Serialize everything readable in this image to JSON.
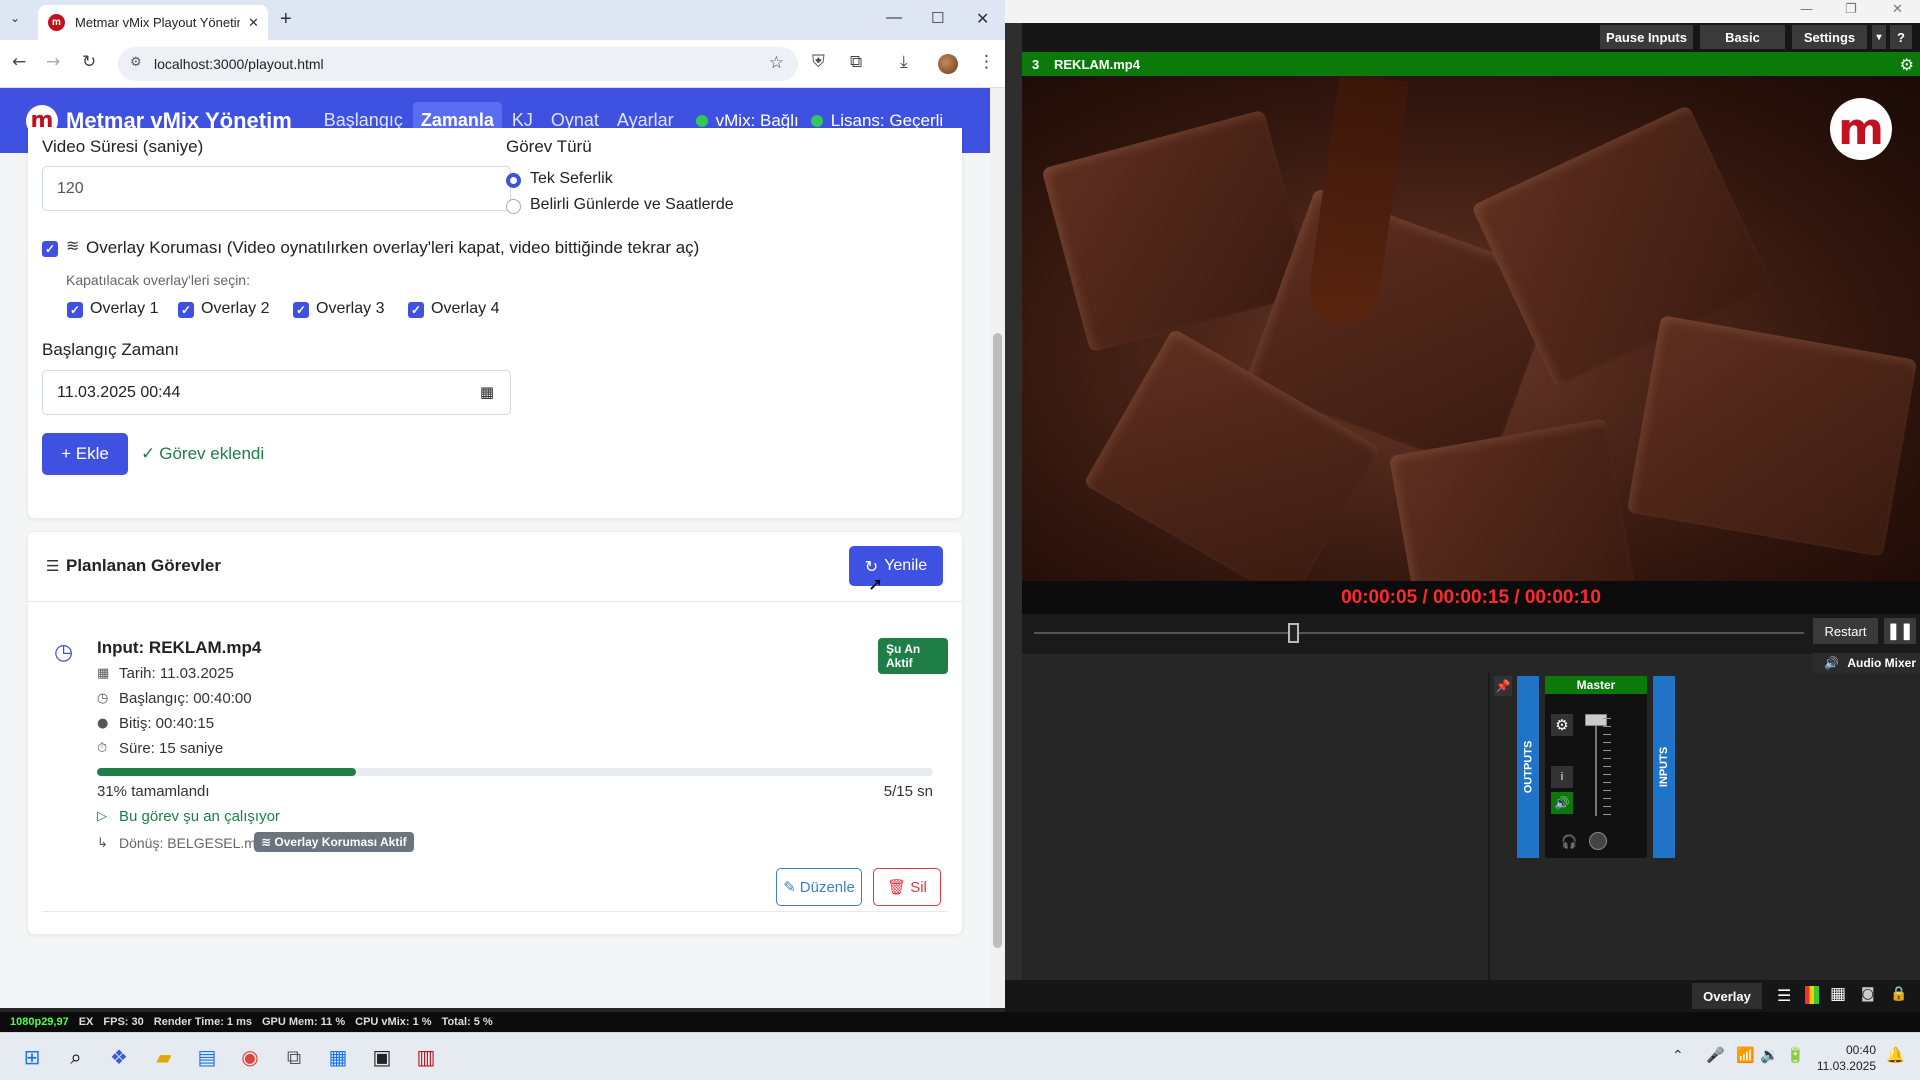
{
  "browser": {
    "tab_title": "Metmar vMix Playout Yönetim",
    "url": "localhost:3000/playout.html"
  },
  "navbar": {
    "brand": "Metmar vMix Yönetim",
    "links": [
      "Başlangıç",
      "Zamanla",
      "KJ",
      "Oynat",
      "Ayarlar"
    ],
    "active_link": "Zamanla",
    "vmix_status": "vMix: Bağlı",
    "license_status": "Lisans: Geçerli"
  },
  "form": {
    "duration_label": "Video Süresi (saniye)",
    "duration_value": "120",
    "task_type_label": "Görev Türü",
    "task_type_once": "Tek Seferlik",
    "task_type_recurring": "Belirli Günlerde ve Saatlerde",
    "overlay_protection_label": "Overlay Koruması (Video oynatılırken overlay'leri kapat, video bittiğinde tekrar aç)",
    "overlay_select_label": "Kapatılacak overlay'leri seçin:",
    "overlays": [
      "Overlay 1",
      "Overlay 2",
      "Overlay 3",
      "Overlay 4"
    ],
    "start_time_label": "Başlangıç Zamanı",
    "start_time_value": "11.03.2025 00:44",
    "add_button": "+ Ekle",
    "success_message": "Görev eklendi"
  },
  "tasks": {
    "title": "Planlanan Görevler",
    "refresh_button": "Yenile",
    "items": [
      {
        "input": "Input: REKLAM.mp4",
        "status": "Şu An Aktif",
        "date": "Tarih: 11.03.2025",
        "start": "Başlangıç: 00:40:00",
        "end": "Bitiş: 00:40:15",
        "duration": "Süre: 15 saniye",
        "progress": 0.31,
        "progress_text": "31% tamamlandı",
        "progress_seconds": "5/15 sn",
        "running_text": "Bu görev şu an çalışıyor",
        "return_text": "Dönüş: BELGESEL.mp4",
        "overlay_badge": "Overlay Koruması Aktif",
        "edit_button": "Düzenle",
        "delete_button": "Sil"
      }
    ]
  },
  "vmix": {
    "top_buttons": [
      "Pause Inputs",
      "Basic",
      "Settings",
      "?"
    ],
    "output_number": "3",
    "output_name": "REKLAM.mp4",
    "timecode": "00:00:05  /  00:00:15  /  00:00:10",
    "restart_button": "Restart",
    "audio_mixer_label": "Audio Mixer",
    "mixer_outputs": "OUTPUTS",
    "mixer_inputs": "INPUTS",
    "mixer_master": "Master",
    "overlay_button": "Overlay",
    "progress": 0.33,
    "status_bar": {
      "resolution": "1080p29,97",
      "ex": "EX",
      "fps": "FPS:  30",
      "render": "Render Time:  1 ms",
      "gpu": "GPU Mem:  11 %",
      "cpu": "CPU vMix:  1 %",
      "total": "Total:  5 %"
    }
  },
  "taskbar": {
    "time": "00:40",
    "date": "11.03.2025"
  },
  "colors": {
    "primary": "#3f51e0",
    "success": "#1e7e46",
    "danger": "#dc3545",
    "vmix_green": "#0b7a0b",
    "vmix_timecode": "#ff2a2a"
  }
}
